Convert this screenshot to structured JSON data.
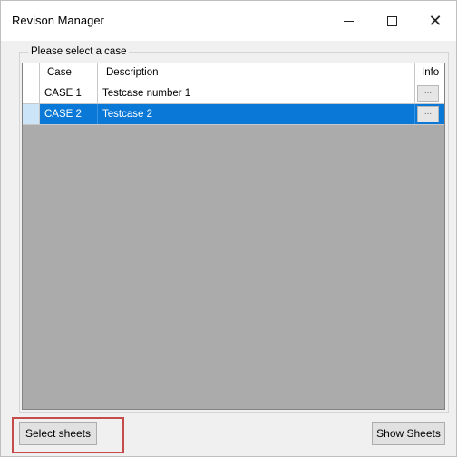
{
  "window": {
    "title": "Revison Manager"
  },
  "group": {
    "label": "Please select a case"
  },
  "grid": {
    "columns": [
      "Case",
      "Description",
      "Info"
    ],
    "rows": [
      {
        "case": "CASE 1",
        "description": "Testcase number 1",
        "info_button": "...",
        "selected": false
      },
      {
        "case": "CASE 2",
        "description": "Testcase 2",
        "info_button": "...",
        "selected": true
      }
    ],
    "selection_color": "#0a78d7",
    "empty_area_color": "#ababab"
  },
  "buttons": {
    "select_sheets": "Select sheets",
    "show_sheets": "Show Sheets"
  },
  "annotation": {
    "highlight_color": "#c64b4b",
    "target": "Select sheets"
  },
  "icons": [
    "minimize-icon",
    "maximize-icon",
    "close-icon"
  ]
}
